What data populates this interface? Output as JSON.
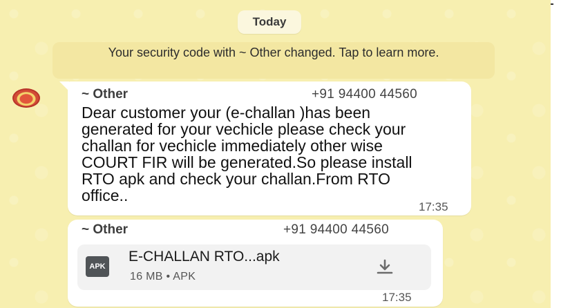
{
  "date_chip": "Today",
  "system_notice": "Your security code with ~ Other changed. Tap to learn more.",
  "messages": [
    {
      "sender": "~ Other",
      "phone": "+91 94400 44560",
      "text": "Dear customer your (e-challan )has been generated for your vechicle please check your challan for vechicle immediately other wise COURT FIR will be generated.So please install RTO apk and check your challan.From RTO office..",
      "time": "17:35"
    },
    {
      "sender": "~ Other",
      "phone": "+91 94400 44560",
      "file": {
        "type_label": "APK",
        "name": "E-CHALLAN RTO...apk",
        "meta": "16 MB • APK",
        "icon": "download-icon"
      },
      "time": "17:35"
    }
  ],
  "colors": {
    "chat_background": "#f7efb0",
    "bubble": "#ffffff",
    "notice": "#f3e7a2",
    "file_card": "#f2f2f2",
    "download_icon": "#6b6b6b"
  }
}
